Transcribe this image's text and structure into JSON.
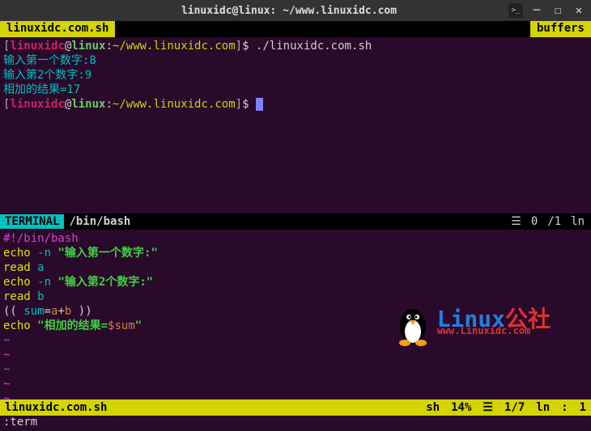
{
  "titlebar": {
    "title": "linuxidc@linux: ~/www.linuxidc.com",
    "icon": ">_"
  },
  "tabs": {
    "left": "linuxidc.com.sh",
    "right": "buffers"
  },
  "terminal": {
    "prompt": {
      "lbracket": "[",
      "user": "linuxidc",
      "at": "@",
      "host": "linux",
      "sep": ":",
      "path": "~/www.linuxidc.com",
      "rbracket": "]",
      "dollar": "$"
    },
    "cmd1": "./linuxidc.com.sh",
    "out1": "输入第一个数字:8",
    "out2": "输入第2个数字:9",
    "out3": "相加的结果=17"
  },
  "split": {
    "label": "TERMINAL",
    "shell": "/bin/bash",
    "count": "0",
    "page": "/1",
    "ln": "ln"
  },
  "script": {
    "shebang": "#!/bin/bash",
    "l2": {
      "echo": "echo",
      "flag": "-n",
      "q": "\"",
      "str": "输入第一个数字:"
    },
    "l3": {
      "read": "read",
      "var": "a"
    },
    "l4": {
      "echo": "echo",
      "flag": "-n",
      "q": "\"",
      "str": "输入第2个数字:"
    },
    "l5": {
      "read": "read",
      "var": "b"
    },
    "l6": {
      "open": "(( ",
      "sum": "sum",
      "eq": "=",
      "a": "a",
      "plus": "+",
      "b": "b",
      "close": " ))"
    },
    "l7": {
      "echo": "echo",
      "q": "\"",
      "str": "相加的结果=",
      "var": "$sum"
    }
  },
  "tilde": "~",
  "watermark": {
    "linux": "Linux",
    "gs": "公社",
    "url": "www.Linuxidc.com"
  },
  "status": {
    "file": "linuxidc.com.sh",
    "ft": "sh",
    "pct": "14%",
    "ham": "☰",
    "pos": "1/7",
    "ln": "ln",
    "colon": ":",
    "col": "1"
  },
  "cmd": ":term"
}
